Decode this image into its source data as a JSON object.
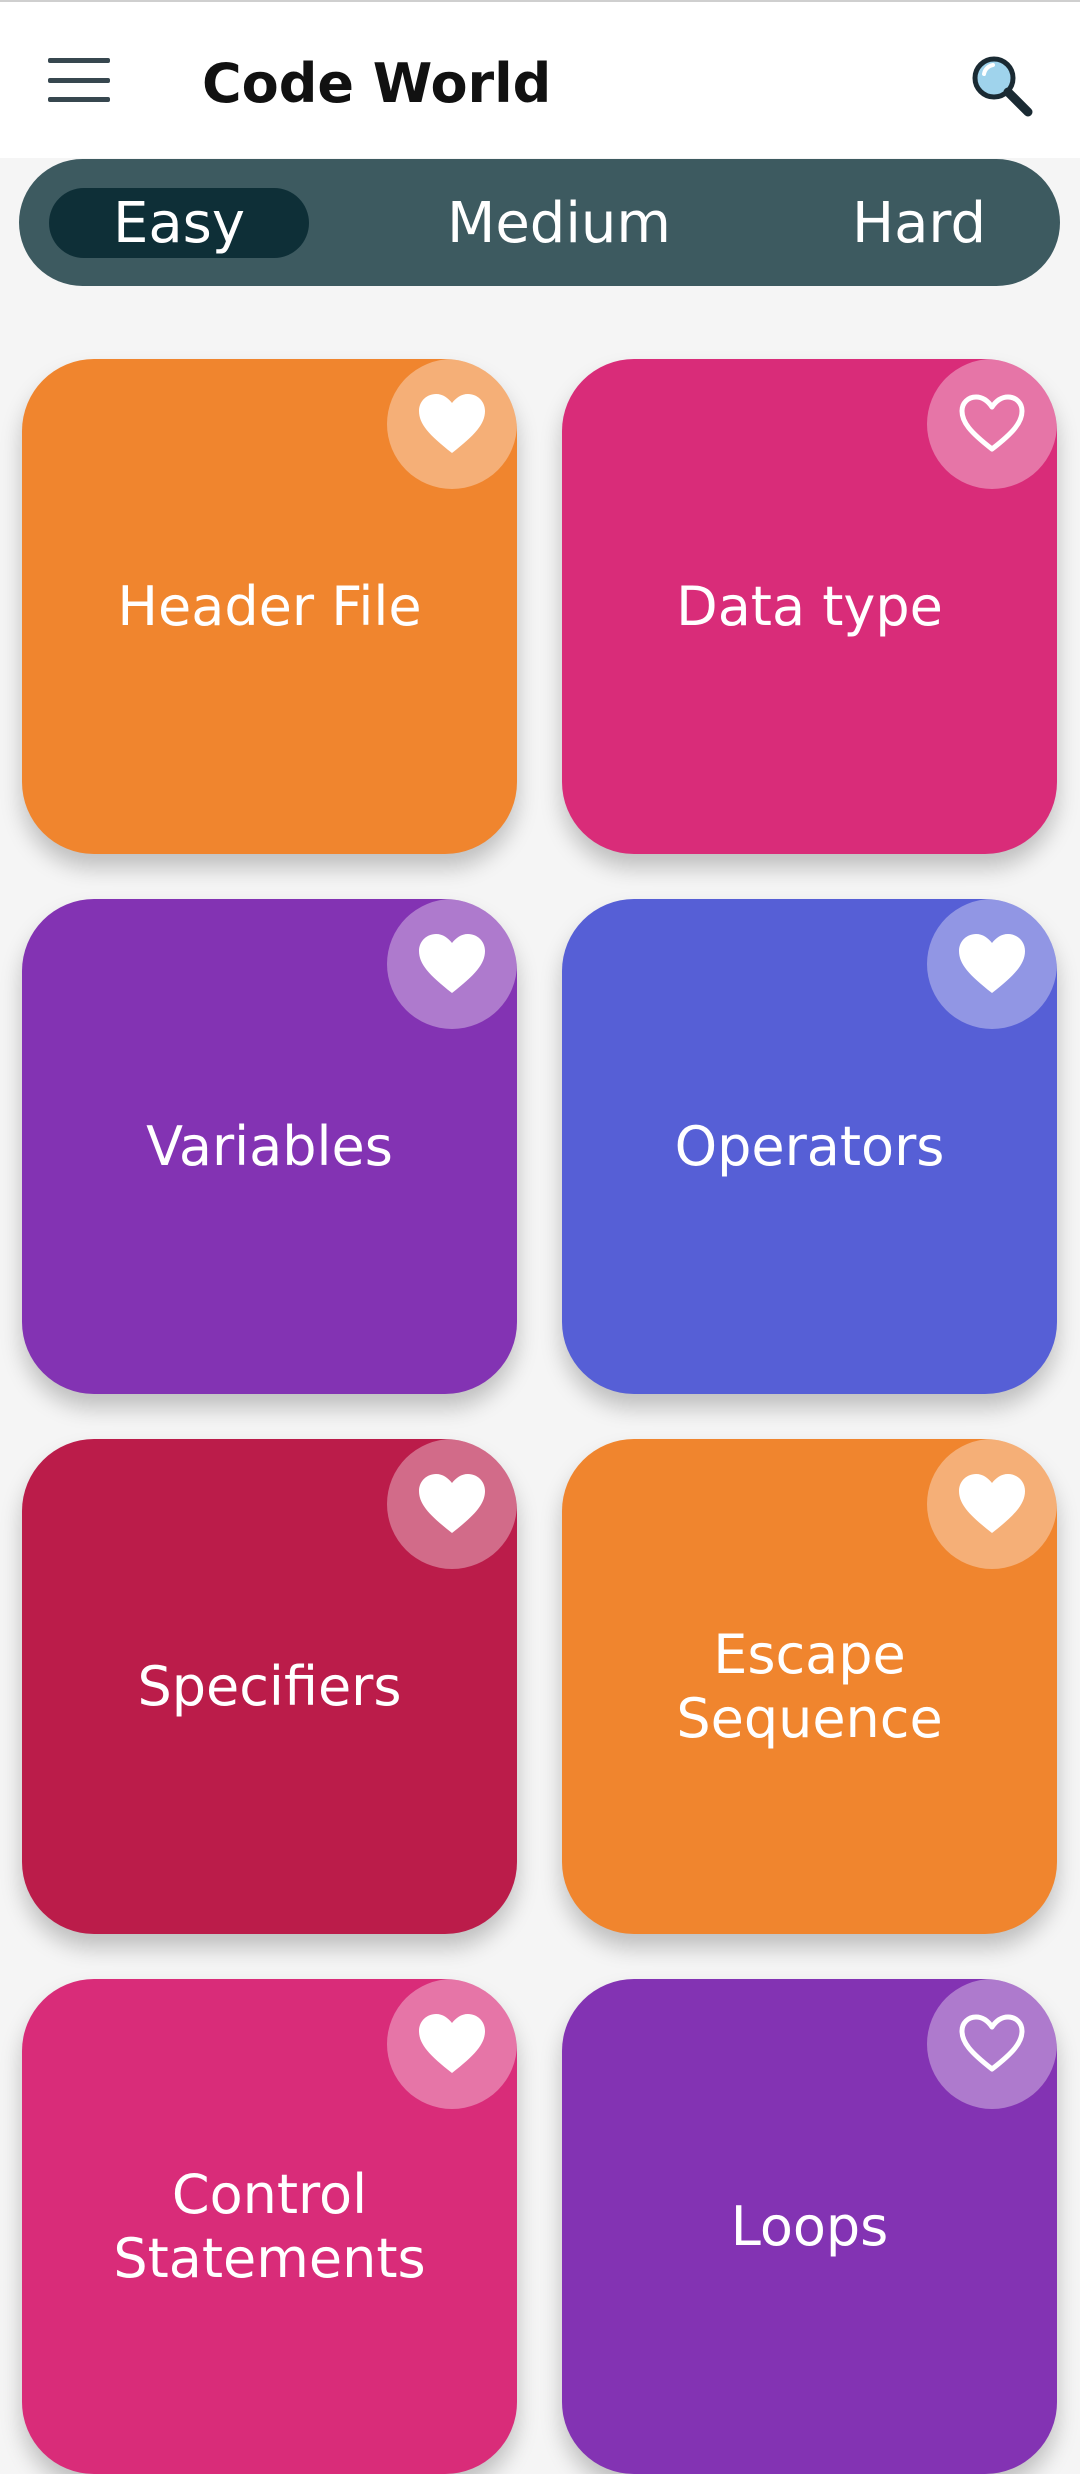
{
  "app_bar": {
    "title": "Code World",
    "menu_icon": "hamburger-menu-icon",
    "search_icon": "magnifier-search-icon"
  },
  "difficulty_tabs": [
    {
      "label": "Easy",
      "selected": true
    },
    {
      "label": "Medium",
      "selected": false
    },
    {
      "label": "Hard",
      "selected": false
    }
  ],
  "topics": [
    {
      "label": "Header File",
      "color": "#f0852e",
      "favorite": true
    },
    {
      "label": "Data type",
      "color": "#d92c79",
      "favorite": false
    },
    {
      "label": "Variables",
      "color": "#8333b3",
      "favorite": true
    },
    {
      "label": "Operators",
      "color": "#565fd6",
      "favorite": true
    },
    {
      "label": "Specifiers",
      "color": "#bb1c4a",
      "favorite": true
    },
    {
      "label": "Escape\nSequence",
      "color": "#f0852e",
      "favorite": true
    },
    {
      "label": "Control\nStatements",
      "color": "#d92c79",
      "favorite": true
    },
    {
      "label": "Loops",
      "color": "#8333b3",
      "favorite": false
    }
  ],
  "colors": {
    "tab_bar": "#3d5a60",
    "tab_selected": "#0e2f37",
    "app_bar_bg": "#ffffff",
    "page_bg": "#f5f5f5"
  }
}
